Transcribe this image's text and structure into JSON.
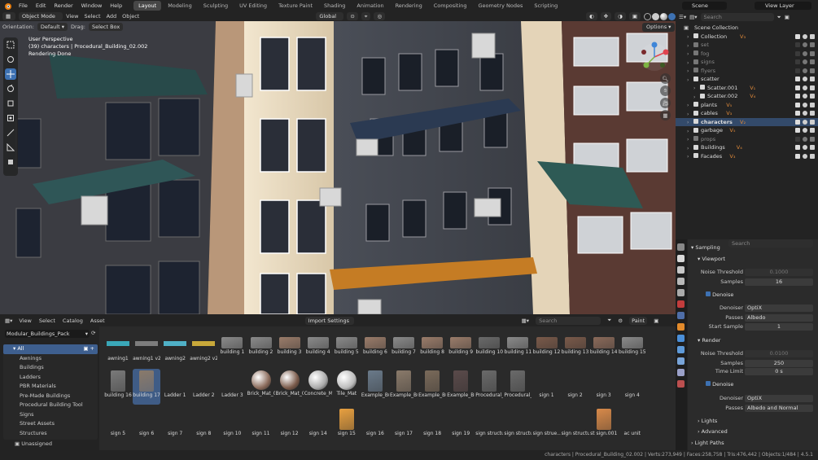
{
  "menubar": {
    "items": [
      "File",
      "Edit",
      "Render",
      "Window",
      "Help"
    ],
    "workspaces": [
      "Layout",
      "Modeling",
      "Sculpting",
      "UV Editing",
      "Texture Paint",
      "Shading",
      "Animation",
      "Rendering",
      "Compositing",
      "Geometry Nodes",
      "Scripting"
    ],
    "active_workspace": "Layout",
    "scene": "Scene",
    "view_layer": "View Layer"
  },
  "viewport_header": {
    "mode": "Object Mode",
    "menus": [
      "View",
      "Select",
      "Add",
      "Object"
    ],
    "transform": "Global",
    "orientation_label": "Orientation:",
    "orientation_value": "Default",
    "drag_label": "Drag:",
    "drag_value": "Select Box",
    "options": "Options"
  },
  "viewport_overlay": {
    "line1": "User Perspective",
    "line2": "(39) characters | Procedural_Building_02.002",
    "line3": "Rendering Done"
  },
  "asset_browser": {
    "menus": [
      "View",
      "Select",
      "Catalog",
      "Asset"
    ],
    "import_settings": "Import Settings",
    "search_placeholder": "Search",
    "paint_label": "Paint",
    "library": "Modular_Buildings_Pack",
    "all_label": "All",
    "catalogs": [
      "Awnings",
      "Buildings",
      "Ladders",
      "PBR Materials",
      "Pre-Made Buildings",
      "Procedural Building Tool",
      "Signs",
      "Street Assets",
      "Structures"
    ],
    "unassigned": "Unassigned",
    "assets": [
      [
        "awning1",
        "awning1 v2",
        "awning2",
        "awning2 v2",
        "building 1",
        "building 2",
        "building 3",
        "building 4",
        "building 5",
        "building 6",
        "building 7",
        "building 8",
        "building 9",
        "building 10",
        "building 11",
        "building 12",
        "building 13",
        "building 14",
        "building 15"
      ],
      [
        "building 16",
        "building 17",
        "Ladder 1",
        "Ladder 2",
        "Ladder 3",
        "Brick_Mat_01",
        "Brick_Mat_02",
        "Concrete_Mat",
        "Tile_Mat",
        "Example_Buil..._01",
        "Example_Buil..._02",
        "Example_Buil..._03",
        "Example_Buil..._04",
        "Procedural_Bui..._01",
        "Procedural_Bui..._02",
        "sign 1",
        "sign 2",
        "sign 3",
        "sign 4"
      ],
      [
        "sign 5",
        "sign 6",
        "sign 7",
        "sign 8",
        "sign 10",
        "sign 11",
        "sign 12",
        "sign 14",
        "sign 15",
        "sign 16",
        "sign 17",
        "sign 18",
        "sign 19",
        "sign structure 1",
        "sign structure 9",
        "sign strue...e 13",
        "sign structure2",
        "st sign.001",
        "ac unit"
      ]
    ],
    "selected_asset": "building 17"
  },
  "outliner": {
    "search_placeholder": "Search",
    "root": "Scene Collection",
    "rows": [
      {
        "name": "Collection",
        "indent": 1,
        "enabled": true,
        "badge": "V₃"
      },
      {
        "name": "set",
        "indent": 1,
        "enabled": false,
        "badge": ""
      },
      {
        "name": "fog",
        "indent": 1,
        "enabled": false,
        "badge": ""
      },
      {
        "name": "signs",
        "indent": 1,
        "enabled": false,
        "badge": ""
      },
      {
        "name": "flyers",
        "indent": 1,
        "enabled": false,
        "badge": ""
      },
      {
        "name": "scatter",
        "indent": 1,
        "enabled": true,
        "badge": ""
      },
      {
        "name": "Scatter.001",
        "indent": 2,
        "enabled": true,
        "badge": "V₁"
      },
      {
        "name": "Scatter.002",
        "indent": 2,
        "enabled": true,
        "badge": "V₄"
      },
      {
        "name": "plants",
        "indent": 1,
        "enabled": true,
        "badge": "V₅"
      },
      {
        "name": "cables",
        "indent": 1,
        "enabled": true,
        "badge": "V₃"
      },
      {
        "name": "characters",
        "indent": 1,
        "enabled": true,
        "badge": "V₂"
      },
      {
        "name": "garbage",
        "indent": 1,
        "enabled": true,
        "badge": "V₅"
      },
      {
        "name": "props",
        "indent": 1,
        "enabled": false,
        "badge": ""
      },
      {
        "name": "Buildings",
        "indent": 1,
        "enabled": true,
        "badge": "V₄"
      },
      {
        "name": "Facades",
        "indent": 1,
        "enabled": true,
        "badge": "V₃"
      }
    ]
  },
  "properties": {
    "search_placeholder": "Search",
    "section_sampling": "Sampling",
    "viewport": "Viewport",
    "noise_threshold_label": "Noise Threshold",
    "viewport_noise_threshold": "0.1000",
    "samples_label": "Samples",
    "viewport_samples": "16",
    "denoise_label": "Denoise",
    "denoiser_label": "Denoiser",
    "denoiser_value": "OptiX",
    "passes_label": "Passes",
    "viewport_passes": "Albedo",
    "start_sample_label": "Start Sample",
    "start_sample": "1",
    "render": "Render",
    "render_noise_threshold": "0.0100",
    "render_samples": "250",
    "time_limit_label": "Time Limit",
    "time_limit": "0 s",
    "render_denoiser": "OptiX",
    "render_passes": "Albedo and Normal",
    "lights": "Lights",
    "advanced": "Advanced",
    "light_paths": "Light Paths"
  },
  "statusbar": {
    "text": "characters | Procedural_Building_02.002 | Verts:273,949 | Faces:258,758 | Tris:476,442 | Objects:1/484 | 4.5.1"
  },
  "colors": {
    "accent": "#3d71b2",
    "selected": "#3f5c86",
    "bg": "#1d1d1d",
    "panel": "#232323"
  }
}
